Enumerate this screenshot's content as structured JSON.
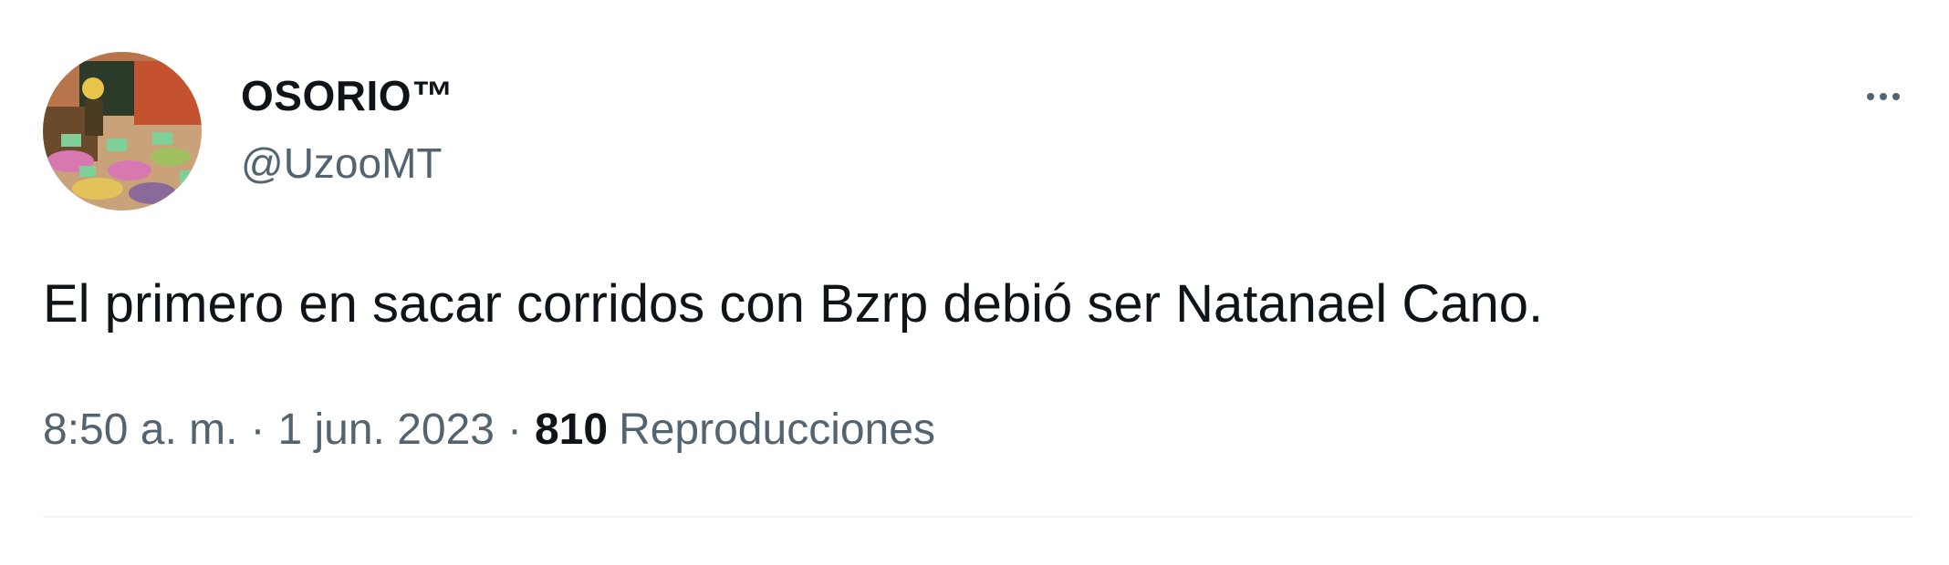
{
  "author": {
    "display_name": "OSORIO™",
    "handle": "@UzooMT",
    "avatar_icon": "profile-avatar"
  },
  "tweet": {
    "text": "El primero en sacar corridos con Bzrp debió ser Natanael Cano."
  },
  "meta": {
    "time": "8:50 a. m.",
    "separator": "·",
    "date": "1 jun. 2023",
    "view_count": "810",
    "views_label": "Reproducciones"
  },
  "menu": {
    "more_icon": "more-horizontal-icon"
  },
  "colors": {
    "primary_text": "#0f1419",
    "secondary_text": "#536471",
    "divider": "#eff3f4"
  }
}
